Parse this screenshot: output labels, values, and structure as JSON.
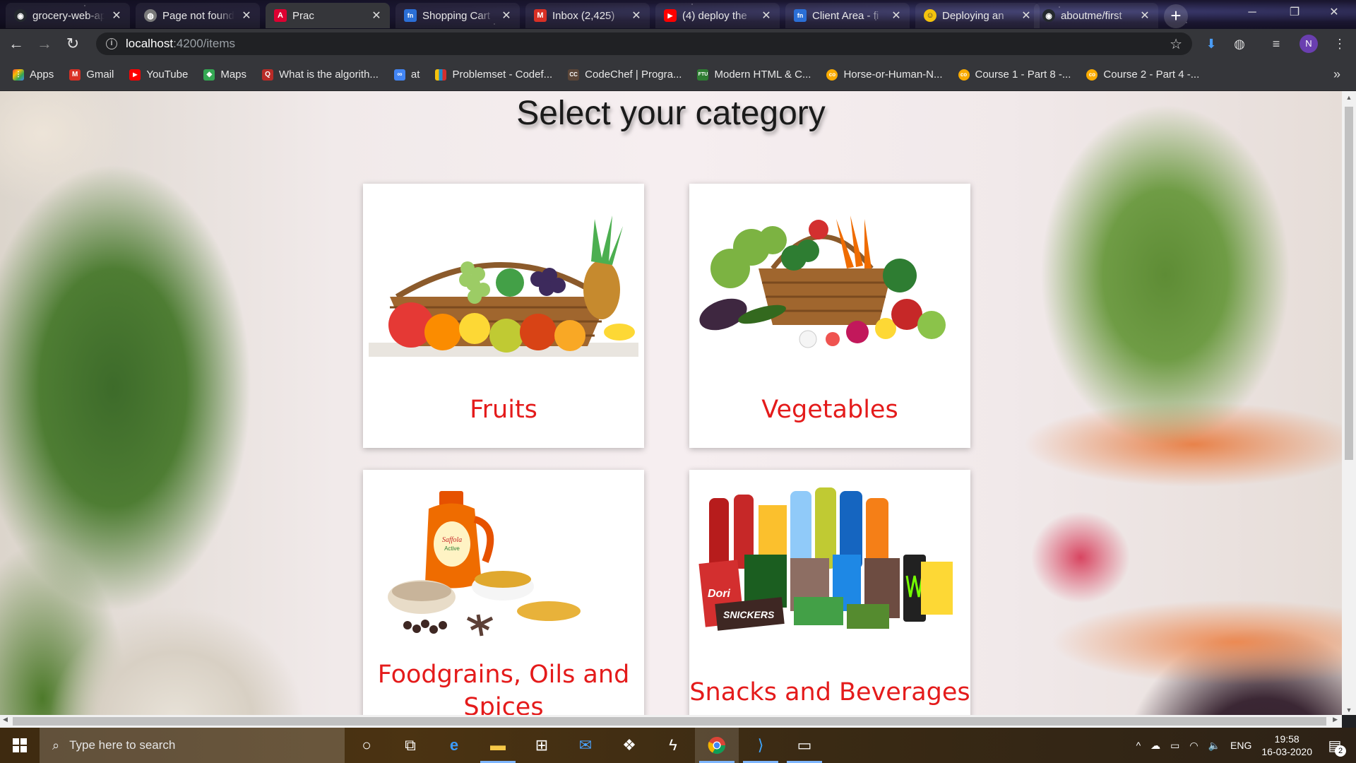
{
  "browser": {
    "tabs": [
      {
        "title": "grocery-web-app",
        "icon": "github-icon",
        "color": "#24292e",
        "glyph": "◉",
        "active": false
      },
      {
        "title": "Page not found",
        "icon": "globe-icon",
        "color": "#7a7a7a",
        "glyph": "◍",
        "active": false
      },
      {
        "title": "Prac",
        "icon": "angular-icon",
        "color": "#dd0031",
        "glyph": "A",
        "active": true
      },
      {
        "title": "Shopping Cart",
        "icon": "fn-icon",
        "color": "#2b6fd6",
        "glyph": "fn",
        "active": false
      },
      {
        "title": "Inbox (2,425)",
        "icon": "gmail-icon",
        "color": "#d93025",
        "glyph": "M",
        "active": false
      },
      {
        "title": "(4) deploy the",
        "icon": "youtube-icon",
        "color": "#ff0000",
        "glyph": "▶",
        "active": false
      },
      {
        "title": "Client Area - fi",
        "icon": "fn-icon",
        "color": "#2b6fd6",
        "glyph": "fn",
        "active": false
      },
      {
        "title": "Deploying an",
        "icon": "emoji-icon",
        "color": "#f4c20d",
        "glyph": "☺",
        "active": false
      },
      {
        "title": "aboutme/first",
        "icon": "github-icon",
        "color": "#24292e",
        "glyph": "◉",
        "active": false
      }
    ],
    "url_host": "localhost",
    "url_path": ":4200/items",
    "bookmarks": [
      {
        "label": "Apps",
        "icon": "apps-grid-icon",
        "color": "#ea4335",
        "glyph": "⋮"
      },
      {
        "label": "Gmail",
        "icon": "gmail-icon",
        "color": "#d93025",
        "glyph": "M"
      },
      {
        "label": "YouTube",
        "icon": "youtube-icon",
        "color": "#ff0000",
        "glyph": "▶"
      },
      {
        "label": "Maps",
        "icon": "maps-icon",
        "color": "#34a853",
        "glyph": "◆"
      },
      {
        "label": "What is the algorith...",
        "icon": "quora-icon",
        "color": "#b92b27",
        "glyph": "Q"
      },
      {
        "label": "at",
        "icon": "infinity-icon",
        "color": "#4285f4",
        "glyph": "∞"
      },
      {
        "label": "Problemset - Codef...",
        "icon": "codeforces-icon",
        "color": "#1f8acb",
        "glyph": "▮"
      },
      {
        "label": "CodeChef | Progra...",
        "icon": "codechef-icon",
        "color": "#5b4638",
        "glyph": "CC"
      },
      {
        "label": "Modern HTML & C...",
        "icon": "ftu-icon",
        "color": "#2e7d32",
        "glyph": "F"
      },
      {
        "label": "Horse-or-Human-N...",
        "icon": "colab-icon",
        "color": "#f9ab00",
        "glyph": "co"
      },
      {
        "label": "Course 1 - Part 8 -...",
        "icon": "colab-icon",
        "color": "#f9ab00",
        "glyph": "co"
      },
      {
        "label": "Course 2 - Part 4 -...",
        "icon": "colab-icon",
        "color": "#f9ab00",
        "glyph": "co"
      }
    ],
    "more_glyph": "»",
    "avatar_letter": "N"
  },
  "page": {
    "title": "Select your category",
    "categories": [
      {
        "label": "Fruits",
        "image": "fruit-basket-image"
      },
      {
        "label": "Vegetables",
        "image": "vegetable-basket-image"
      },
      {
        "label": "Foodgrains, Oils and Spices",
        "image": "foodgrains-oils-image"
      },
      {
        "label": "Snacks and Beverages",
        "image": "snacks-beverages-image"
      }
    ],
    "label_color": "#e41b1b"
  },
  "taskbar": {
    "search_placeholder": "Type here to search",
    "language": "ENG",
    "time": "19:58",
    "date": "16-03-2020",
    "notification_count": "2",
    "apps": [
      "cortana-icon",
      "task-view-icon",
      "edge-icon",
      "file-explorer-icon",
      "store-icon",
      "mail-icon",
      "dropbox-icon",
      "app-lightning-icon",
      "chrome-icon",
      "vscode-icon",
      "terminal-icon"
    ]
  }
}
